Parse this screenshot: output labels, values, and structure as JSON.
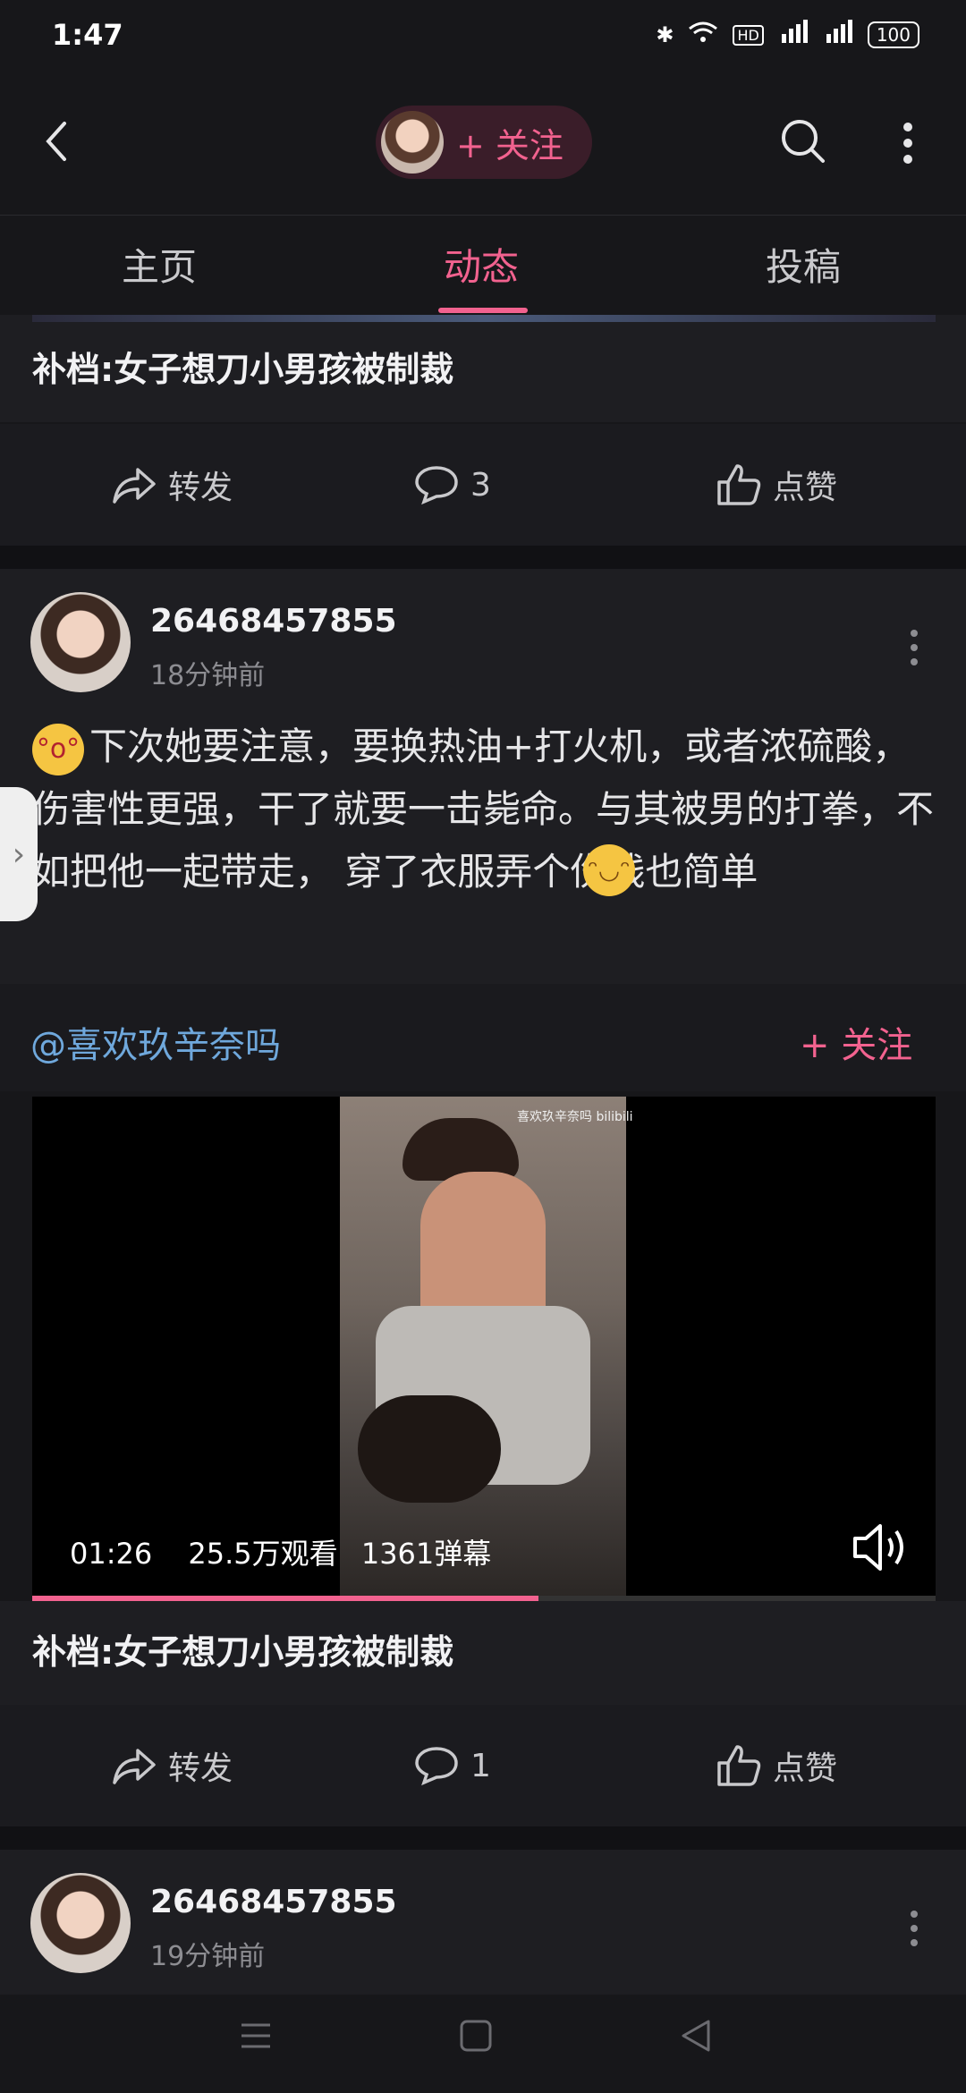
{
  "status_bar": {
    "time": "1:47",
    "battery": "100",
    "icons": [
      "bluetooth-icon",
      "wifi-icon",
      "hd-icon",
      "4g-signal-icon",
      "4g-signal-icon",
      "battery-icon"
    ]
  },
  "header": {
    "follow_label": "+ 关注"
  },
  "tabs": [
    {
      "label": "主页"
    },
    {
      "label": "动态"
    },
    {
      "label": "投稿"
    }
  ],
  "active_tab": "动态",
  "post1": {
    "title": "补档:女子想刀小男孩被制裁",
    "actions": {
      "repost": "转发",
      "comment_count": "3",
      "like": "点赞"
    }
  },
  "post2": {
    "username": "26468457855",
    "time": "18分钟前",
    "text": "下次她要注意，要换热油+打火机，或者浓硫酸，伤害性更强，干了就要一击毙命。与其被男的打拳，不如把他一起带走， 穿了衣服弄个伤残也简单",
    "mention": "@喜欢玖辛奈吗",
    "mention_follow": "+ 关注",
    "video": {
      "watermark": "喜欢玖辛奈吗 bilibili",
      "duration": "01:26",
      "views": "25.5万观看",
      "danmaku": "1361弹幕",
      "progress": 0.56
    },
    "title": "补档:女子想刀小男孩被制裁",
    "actions": {
      "repost": "转发",
      "comment_count": "1",
      "like": "点赞"
    }
  },
  "post3": {
    "username": "26468457855",
    "time": "19分钟前"
  },
  "colors": {
    "accent": "#f2628f",
    "mention": "#6fa8dc",
    "background": "#17171a"
  }
}
